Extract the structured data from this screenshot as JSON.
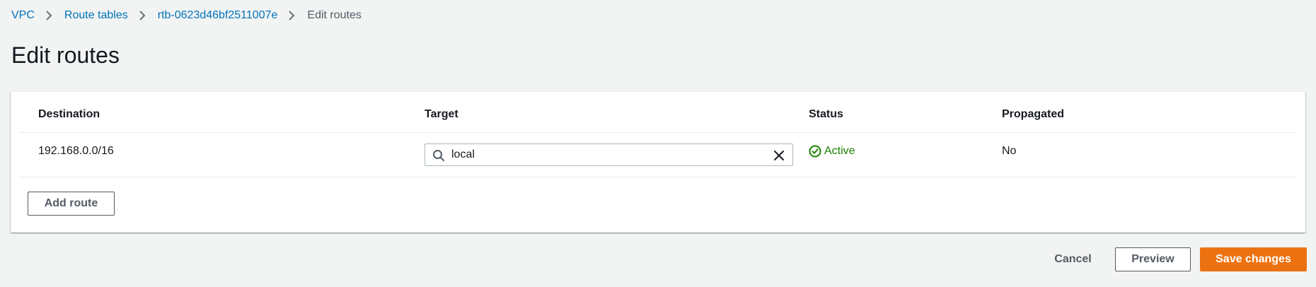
{
  "breadcrumb": {
    "items": [
      {
        "label": "VPC"
      },
      {
        "label": "Route tables"
      },
      {
        "label": "rtb-0623d46bf2511007e"
      },
      {
        "label": "Edit routes"
      }
    ]
  },
  "page": {
    "title": "Edit routes"
  },
  "table": {
    "columns": [
      "Destination",
      "Target",
      "Status",
      "Propagated"
    ],
    "rows": [
      {
        "destination": "192.168.0.0/16",
        "target": "local",
        "status": "Active",
        "propagated": "No"
      }
    ]
  },
  "actions": {
    "add_route": "Add route",
    "cancel": "Cancel",
    "preview": "Preview",
    "save": "Save changes"
  },
  "colors": {
    "link": "#0073bb",
    "status_active": "#1d8102",
    "primary_button": "#ec7211",
    "background": "#f2f3f3"
  },
  "icons": {
    "breadcrumb_separator": "chevron-right-icon",
    "target_search": "search-icon",
    "target_clear": "close-icon",
    "status": "check-circle-icon"
  }
}
